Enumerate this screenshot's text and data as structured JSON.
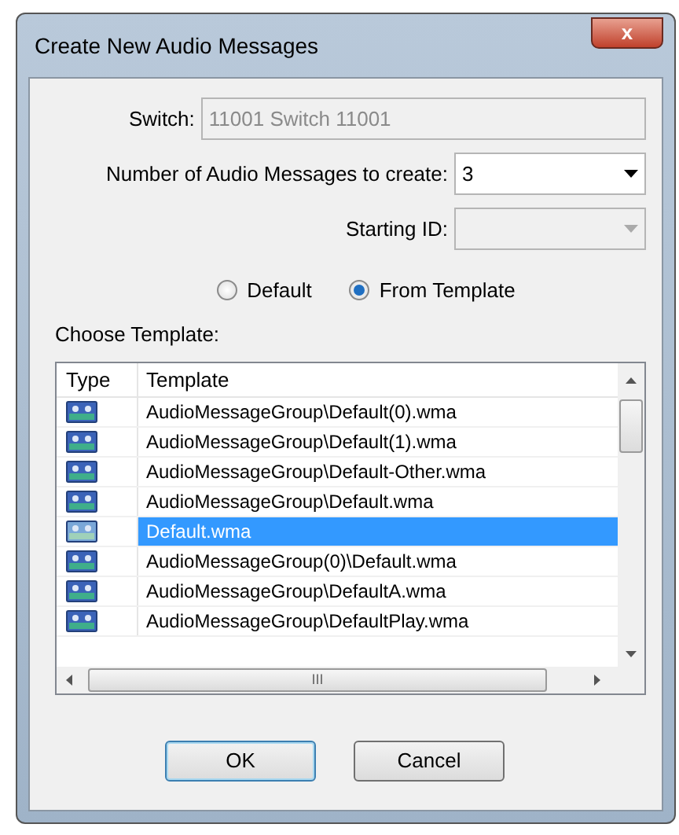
{
  "window": {
    "title": "Create New Audio Messages",
    "close": "x"
  },
  "switch": {
    "label": "Switch:",
    "value": "11001 Switch 11001",
    "disabled": true
  },
  "count": {
    "label": "Number of Audio Messages to create:",
    "value": "3",
    "disabled": false
  },
  "starting_id": {
    "label": "Starting ID:",
    "disabled": true
  },
  "source_options": [
    {
      "label": "Default",
      "selected": false
    },
    {
      "label": "From Template",
      "selected": true
    }
  ],
  "template_label": "Choose Template:",
  "table": {
    "columns": [
      "Type",
      "Template"
    ],
    "rows": [
      {
        "template": "AudioMessageGroup\\Default(0).wma",
        "selected": false
      },
      {
        "template": "AudioMessageGroup\\Default(1).wma",
        "selected": false
      },
      {
        "template": "AudioMessageGroup\\Default-Other.wma",
        "selected": false
      },
      {
        "template": "AudioMessageGroup\\Default.wma",
        "selected": false
      },
      {
        "template": "Default.wma",
        "selected": true
      },
      {
        "template": "AudioMessageGroup(0)\\Default.wma",
        "selected": false
      },
      {
        "template": "AudioMessageGroup\\DefaultA.wma",
        "selected": false
      },
      {
        "template": "AudioMessageGroup\\DefaultPlay.wma",
        "selected": false
      }
    ],
    "hscroll_grip": "III"
  },
  "buttons": [
    {
      "label": "OK",
      "default": true
    },
    {
      "label": "Cancel",
      "default": false
    }
  ]
}
